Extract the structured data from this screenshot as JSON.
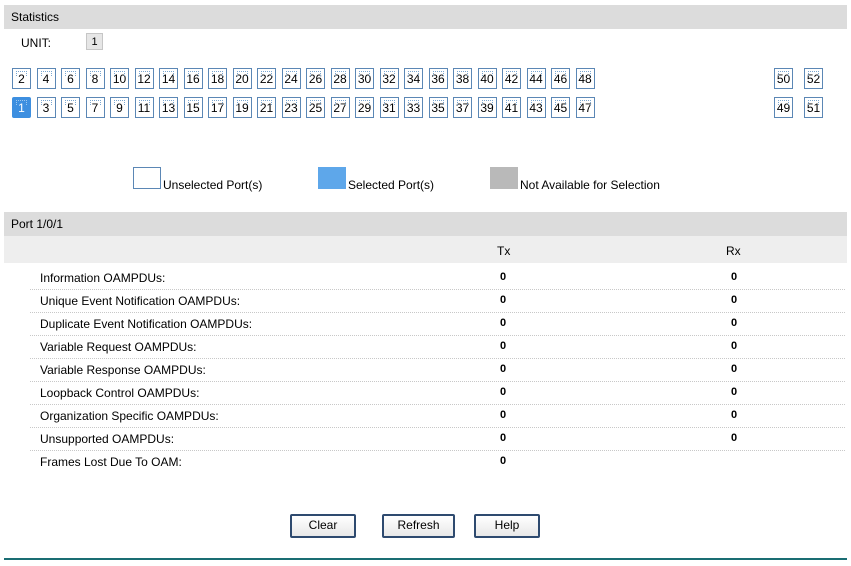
{
  "statistics": {
    "title": "Statistics",
    "unit_label": "UNIT:",
    "unit_value": "1"
  },
  "ports": {
    "top_row": [
      "2",
      "4",
      "6",
      "8",
      "10",
      "12",
      "14",
      "16",
      "18",
      "20",
      "22",
      "24",
      "26",
      "28",
      "30",
      "32",
      "34",
      "36",
      "38",
      "40",
      "42",
      "44",
      "46",
      "48",
      "50",
      "52"
    ],
    "bottom_row": [
      "1",
      "3",
      "5",
      "7",
      "9",
      "11",
      "13",
      "15",
      "17",
      "19",
      "21",
      "23",
      "25",
      "27",
      "29",
      "31",
      "33",
      "35",
      "37",
      "39",
      "41",
      "43",
      "45",
      "47",
      "49",
      "51"
    ],
    "selected": "1"
  },
  "legend": {
    "unselected": "Unselected Port(s)",
    "selected": "Selected Port(s)",
    "not_available": "Not Available for Selection"
  },
  "port_section": {
    "title": "Port 1/0/1",
    "col_tx": "Tx",
    "col_rx": "Rx"
  },
  "rows": [
    {
      "label": "Information OAMPDUs:",
      "tx": "0",
      "rx": "0"
    },
    {
      "label": "Unique Event Notification OAMPDUs:",
      "tx": "0",
      "rx": "0"
    },
    {
      "label": "Duplicate Event Notification OAMPDUs:",
      "tx": "0",
      "rx": "0"
    },
    {
      "label": "Variable Request OAMPDUs:",
      "tx": "0",
      "rx": "0"
    },
    {
      "label": "Variable Response OAMPDUs:",
      "tx": "0",
      "rx": "0"
    },
    {
      "label": "Loopback Control OAMPDUs:",
      "tx": "0",
      "rx": "0"
    },
    {
      "label": "Organization Specific OAMPDUs:",
      "tx": "0",
      "rx": "0"
    },
    {
      "label": "Unsupported OAMPDUs:",
      "tx": "0",
      "rx": "0"
    },
    {
      "label": "Frames Lost Due To OAM:",
      "tx": "0",
      "rx": ""
    }
  ],
  "buttons": {
    "clear": "Clear",
    "refresh": "Refresh",
    "help": "Help"
  }
}
